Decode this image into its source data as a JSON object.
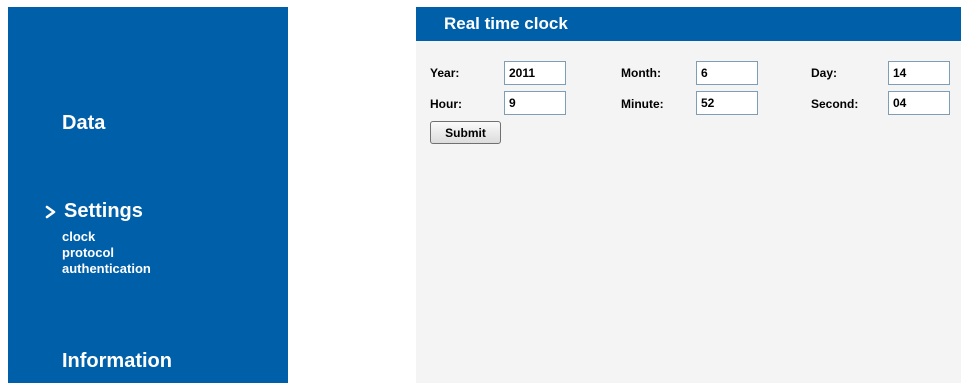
{
  "sidebar": {
    "items": [
      {
        "label": "Data"
      },
      {
        "label": "Settings",
        "active": true,
        "icon": "chevron-right-icon",
        "subitems": [
          {
            "label": "clock"
          },
          {
            "label": "protocol"
          },
          {
            "label": "authentication"
          }
        ]
      },
      {
        "label": "Information"
      }
    ]
  },
  "main": {
    "title": "Real time clock",
    "fields": {
      "year": {
        "label": "Year:",
        "value": "2011"
      },
      "month": {
        "label": "Month:",
        "value": "6"
      },
      "day": {
        "label": "Day:",
        "value": "14"
      },
      "hour": {
        "label": "Hour:",
        "value": "9"
      },
      "minute": {
        "label": "Minute:",
        "value": "52"
      },
      "second": {
        "label": "Second:",
        "value": "04"
      }
    },
    "submit_label": "Submit"
  },
  "colors": {
    "brand": "#005fa9",
    "panel_bg": "#f4f4f4",
    "text_on_brand": "#ffffff"
  }
}
